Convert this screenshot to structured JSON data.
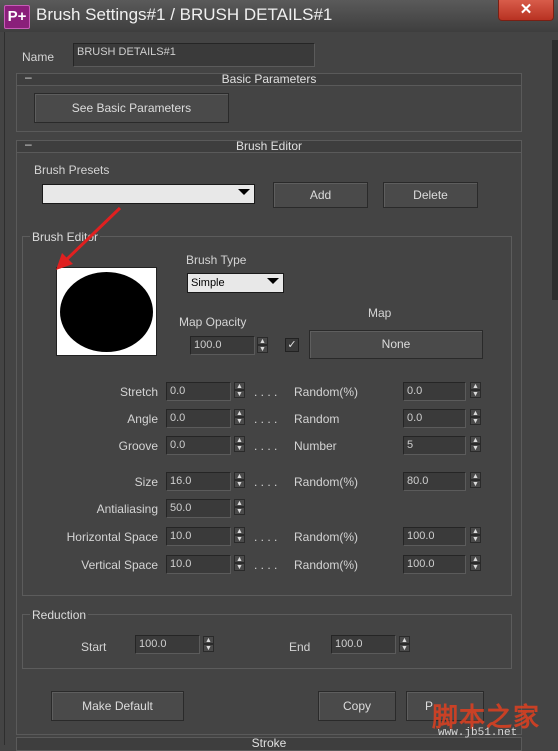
{
  "window": {
    "title": "Brush Settings#1 / BRUSH DETAILS#1",
    "app_icon": "P+",
    "close_symbol": "✕"
  },
  "name_row": {
    "label": "Name",
    "value": "BRUSH DETAILS#1"
  },
  "basic_parameters": {
    "minus": "–",
    "title": "Basic Parameters",
    "button": "See Basic Parameters"
  },
  "brush_editor_rollout": {
    "minus": "–",
    "title": "Brush Editor",
    "presets_label": "Brush Presets",
    "preset_value": "",
    "add": "Add",
    "delete": "Delete"
  },
  "editor": {
    "group_label": "Brush Editor",
    "brush_type_label": "Brush Type",
    "brush_type_value": "Simple",
    "map_opacity_label": "Map Opacity",
    "map_opacity_value": "100.0",
    "map_checkbox_checked": true,
    "map_label": "Map",
    "map_button": "None",
    "dots": ". . . .",
    "rows": [
      {
        "label": "Stretch",
        "value": "0.0",
        "right_label": "Random(%)",
        "right_value": "0.0"
      },
      {
        "label": "Angle",
        "value": "0.0",
        "right_label": "Random",
        "right_value": "0.0"
      },
      {
        "label": "Groove",
        "value": "0.0",
        "right_label": "Number",
        "right_value": "5"
      },
      {
        "label": "Size",
        "value": "16.0",
        "right_label": "Random(%)",
        "right_value": "80.0"
      },
      {
        "label": "Antialiasing",
        "value": "50.0"
      },
      {
        "label": "Horizontal Space",
        "value": "10.0",
        "right_label": "Random(%)",
        "right_value": "100.0"
      },
      {
        "label": "Vertical Space",
        "value": "10.0",
        "right_label": "Random(%)",
        "right_value": "100.0"
      }
    ]
  },
  "reduction": {
    "group_label": "Reduction",
    "start_label": "Start",
    "start_value": "100.0",
    "end_label": "End",
    "end_value": "100.0"
  },
  "footer": {
    "make_default": "Make Default",
    "copy": "Copy",
    "paste": "P"
  },
  "stroke_rollout": {
    "title": "Stroke"
  },
  "watermark": {
    "text": "脚本之家",
    "url": "www.jb51.net"
  },
  "colors": {
    "background": "#444444",
    "annotation_arrow": "#e02020",
    "brush_fill": "#000000"
  }
}
